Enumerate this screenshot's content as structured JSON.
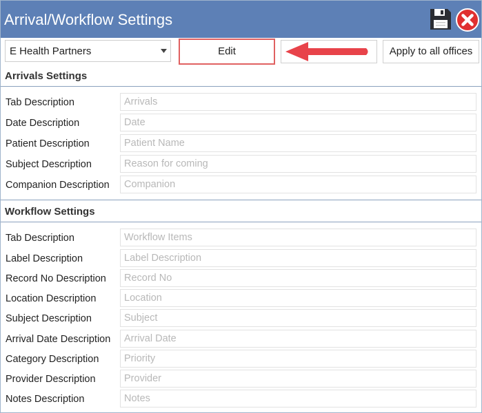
{
  "window": {
    "title": "Arrival/Workflow Settings"
  },
  "toolbar": {
    "office_selected": "E Health Partners",
    "edit_label": "Edit",
    "apply_label": "Apply to all offices"
  },
  "arrivals": {
    "heading": "Arrivals Settings",
    "fields": [
      {
        "label": "Tab Description",
        "placeholder": "Arrivals"
      },
      {
        "label": "Date Description",
        "placeholder": "Date"
      },
      {
        "label": "Patient Description",
        "placeholder": "Patient Name"
      },
      {
        "label": "Subject Description",
        "placeholder": "Reason for coming"
      },
      {
        "label": "Companion Description",
        "placeholder": "Companion"
      }
    ]
  },
  "workflow": {
    "heading": "Workflow Settings",
    "fields": [
      {
        "label": "Tab Description",
        "placeholder": "Workflow Items"
      },
      {
        "label": "Label Description",
        "placeholder": "Label Description"
      },
      {
        "label": "Record No Description",
        "placeholder": "Record No"
      },
      {
        "label": "Location Description",
        "placeholder": "Location"
      },
      {
        "label": "Subject Description",
        "placeholder": "Subject"
      },
      {
        "label": "Arrival Date Description",
        "placeholder": "Arrival Date"
      },
      {
        "label": "Category Description",
        "placeholder": "Priority"
      },
      {
        "label": "Provider Description",
        "placeholder": "Provider"
      },
      {
        "label": "Notes Description",
        "placeholder": "Notes"
      }
    ]
  },
  "colors": {
    "titlebar": "#5d80b6",
    "highlight_border": "#e06060",
    "annotation_arrow": "#e8434a",
    "close_red": "#e03030"
  },
  "icons": {
    "save": "floppy-disk-icon",
    "close": "close-x-icon",
    "dropdown": "chevron-down-icon",
    "annotation": "red-left-arrow"
  }
}
